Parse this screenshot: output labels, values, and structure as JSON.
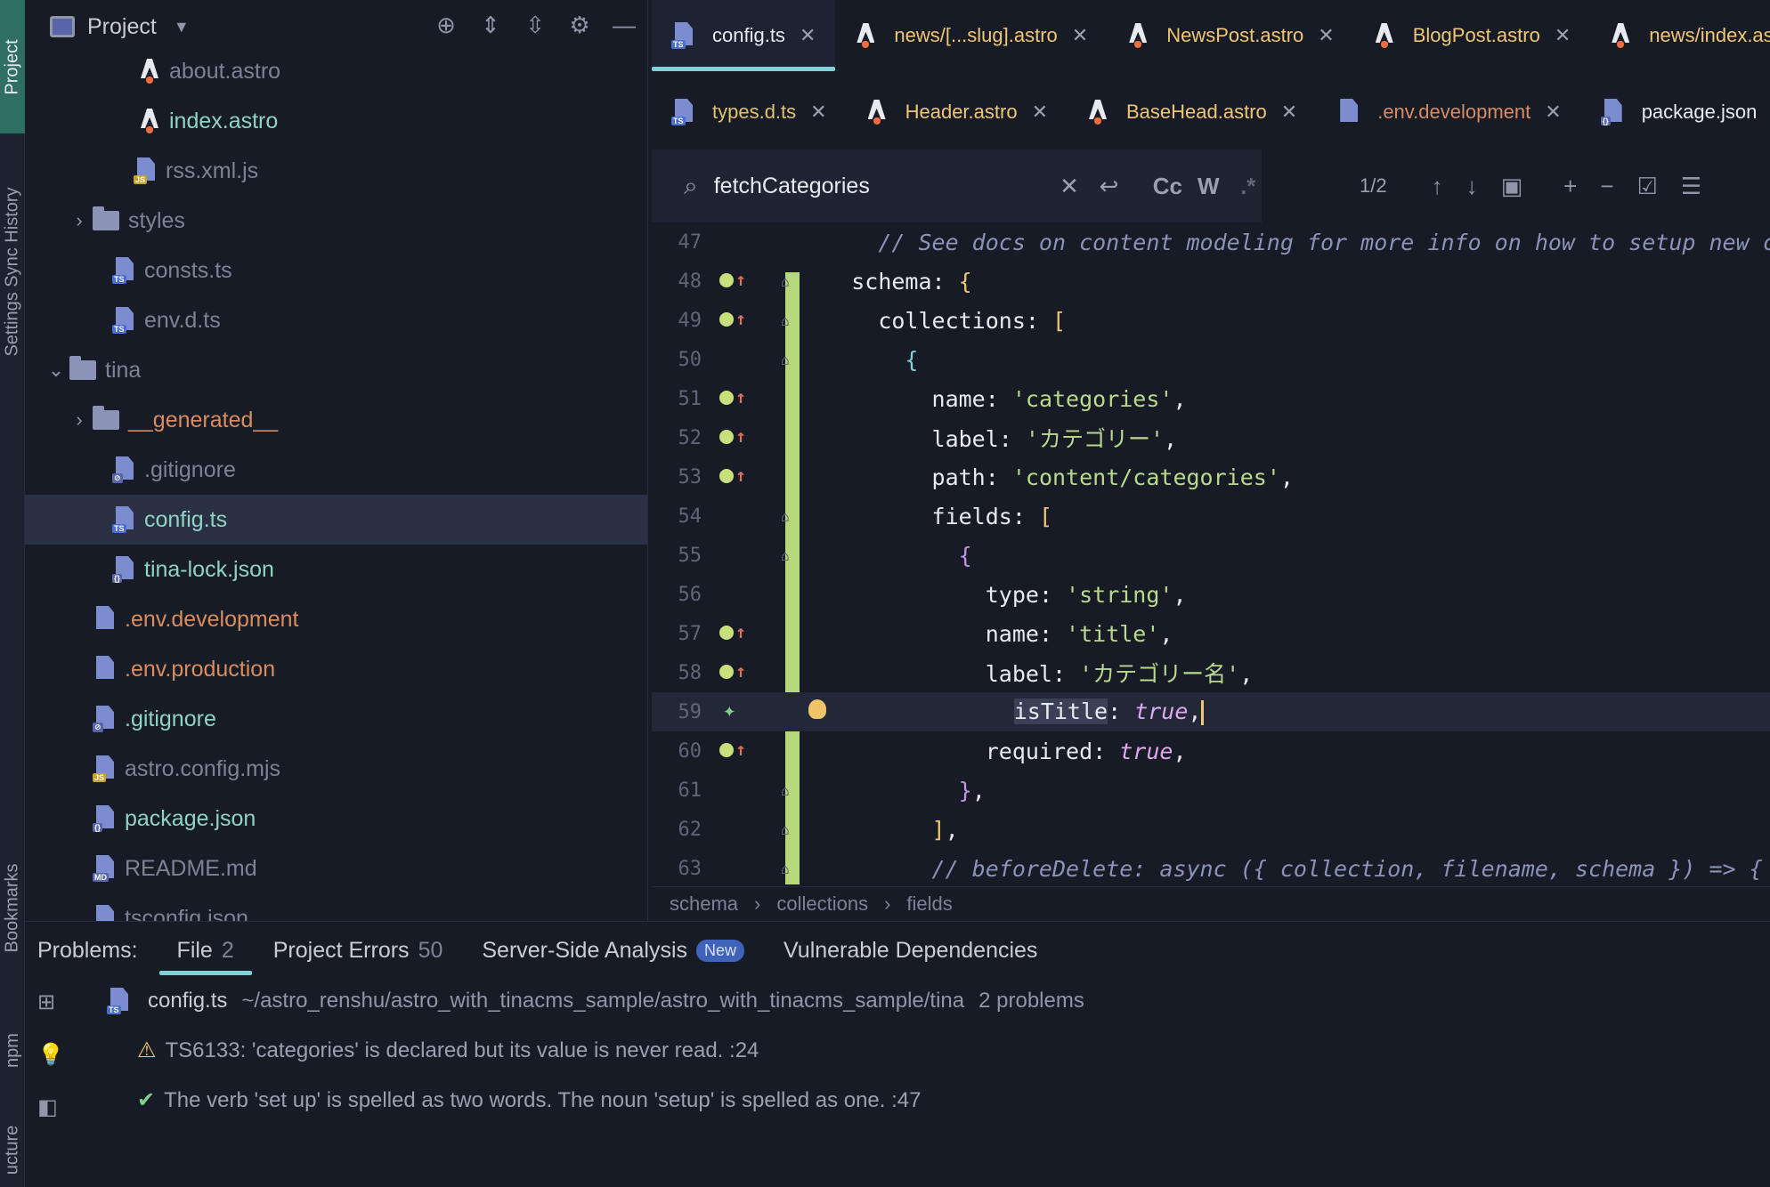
{
  "strip": {
    "project_label": "Project",
    "history_label": "Settings Sync History",
    "bookmarks_label": "Bookmarks",
    "npm_label": "npm",
    "structure_label": "ucture"
  },
  "project_panel": {
    "title": "Project",
    "items": [
      {
        "label": "about.astro",
        "kind": "astro",
        "color": "grey"
      },
      {
        "label": "index.astro",
        "kind": "astro",
        "color": "green"
      },
      {
        "label": "rss.xml.js",
        "kind": "js",
        "color": "grey"
      },
      {
        "label": "styles",
        "kind": "folder",
        "color": "grey",
        "collapsed": true
      },
      {
        "label": "consts.ts",
        "kind": "ts",
        "color": "grey"
      },
      {
        "label": "env.d.ts",
        "kind": "ts",
        "color": "grey"
      },
      {
        "label": "tina",
        "kind": "folder",
        "color": "grey",
        "expanded": true
      },
      {
        "label": "__generated__",
        "kind": "folder",
        "color": "orange",
        "collapsed": true
      },
      {
        "label": ".gitignore",
        "kind": "ignore",
        "color": "grey"
      },
      {
        "label": "config.ts",
        "kind": "ts",
        "color": "green",
        "selected": true
      },
      {
        "label": "tina-lock.json",
        "kind": "json",
        "color": "green"
      },
      {
        "label": ".env.development",
        "kind": "file",
        "color": "orange"
      },
      {
        "label": ".env.production",
        "kind": "file",
        "color": "orange"
      },
      {
        "label": ".gitignore",
        "kind": "ignore",
        "color": "green"
      },
      {
        "label": "astro.config.mjs",
        "kind": "js",
        "color": "grey"
      },
      {
        "label": "package.json",
        "kind": "json",
        "color": "green"
      },
      {
        "label": "README.md",
        "kind": "md",
        "color": "grey"
      },
      {
        "label": "tsconfig.json",
        "kind": "json",
        "color": "grey"
      }
    ]
  },
  "tabs_row1": [
    {
      "label": "config.ts",
      "kind": "ts",
      "active": true
    },
    {
      "label": "news/[...slug].astro",
      "kind": "astro"
    },
    {
      "label": "NewsPost.astro",
      "kind": "astro"
    },
    {
      "label": "BlogPost.astro",
      "kind": "astro"
    },
    {
      "label": "news/index.astro",
      "kind": "astro"
    }
  ],
  "tabs_row2": [
    {
      "label": "types.d.ts",
      "kind": "ts"
    },
    {
      "label": "Header.astro",
      "kind": "astro"
    },
    {
      "label": "BaseHead.astro",
      "kind": "astro"
    },
    {
      "label": ".env.development",
      "kind": "file"
    },
    {
      "label": "package.json",
      "kind": "json"
    }
  ],
  "find": {
    "query": "fetchCategories",
    "case_label": "Cc",
    "word_label": "W",
    "regex_label": ".*",
    "count": "1/2"
  },
  "code": {
    "lines": [
      {
        "n": "47"
      },
      {
        "n": "48"
      },
      {
        "n": "49"
      },
      {
        "n": "50"
      },
      {
        "n": "51"
      },
      {
        "n": "52"
      },
      {
        "n": "53"
      },
      {
        "n": "54"
      },
      {
        "n": "55"
      },
      {
        "n": "56"
      },
      {
        "n": "57"
      },
      {
        "n": "58"
      },
      {
        "n": "59"
      },
      {
        "n": "60"
      },
      {
        "n": "61"
      },
      {
        "n": "62"
      },
      {
        "n": "63"
      }
    ],
    "l47": "// See docs on content modeling for more info on how to setup new con",
    "l48_key": "schema",
    "l49_key": "collections",
    "l51_key": "name",
    "l51_val": "'categories'",
    "l52_key": "label",
    "l52_val": "'カテゴリー'",
    "l53_key": "path",
    "l53_val": "'content/categories'",
    "l54_key": "fields",
    "l56_key": "type",
    "l56_val": "'string'",
    "l57_key": "name",
    "l57_val": "'title'",
    "l58_key": "label",
    "l58_val": "'カテゴリー名'",
    "l59_key": "isTitle",
    "l59_val": "true",
    "l60_key": "required",
    "l60_val": "true",
    "l63": "// beforeDelete: async ({ collection, filename, schema }) => {"
  },
  "breadcrumbs": [
    "schema",
    "collections",
    "fields"
  ],
  "problems": {
    "title": "Problems:",
    "tabs": [
      {
        "label": "File",
        "count": "2"
      },
      {
        "label": "Project Errors",
        "count": "50"
      },
      {
        "label": "Server-Side Analysis",
        "badge": "New"
      },
      {
        "label": "Vulnerable Dependencies"
      }
    ],
    "file_row": {
      "name": "config.ts",
      "path": "~/astro_renshu/astro_with_tinacms_sample/astro_with_tinacms_sample/tina",
      "summary": "2 problems"
    },
    "items": [
      {
        "text": "TS6133: 'categories' is declared but its value is never read. :24",
        "kind": "warning"
      },
      {
        "text": "The verb 'set up' is spelled as two words. The noun 'setup' is spelled as one. :47",
        "kind": "grammar"
      }
    ]
  }
}
